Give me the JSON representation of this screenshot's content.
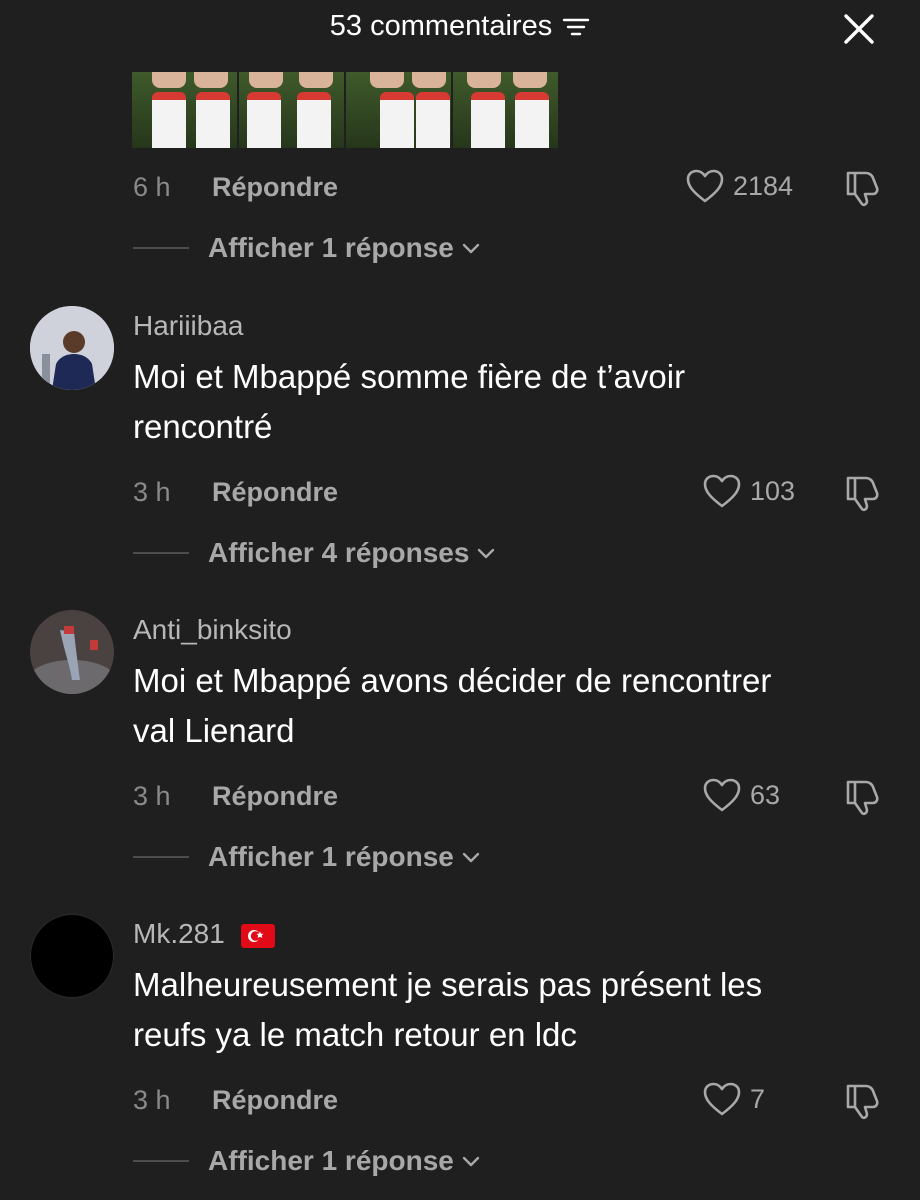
{
  "header": {
    "title": "53 commentaires"
  },
  "comments": [
    {
      "time": "6 h",
      "reply_label": "Répondre",
      "likes": "2184",
      "show_replies": "Afficher 1 réponse"
    },
    {
      "username": "Hariiibaa",
      "text_line1": "Moi et Mbappé somme fière de t’avoir",
      "text_line2": "rencontré",
      "time": "3 h",
      "reply_label": "Répondre",
      "likes": "103",
      "show_replies": "Afficher 4 réponses"
    },
    {
      "username": "Anti_binksito",
      "text_line1": "Moi et Mbappé avons décider de rencontrer",
      "text_line2": "val Lienard",
      "time": "3 h",
      "reply_label": "Répondre",
      "likes": "63",
      "show_replies": "Afficher 1 réponse"
    },
    {
      "username": "Mk.281",
      "flag": "turkey-flag",
      "text_line1": "Malheureusement je serais pas présent les",
      "text_line2": "reufs ya le match retour en ldc",
      "time": "3 h",
      "reply_label": "Répondre",
      "likes": "7",
      "show_replies": "Afficher 1 réponse"
    }
  ],
  "colors": {
    "background": "#1f1f1f",
    "text": "#ffffff",
    "muted": "#a8a8a8",
    "flag_red": "#e30a17"
  }
}
